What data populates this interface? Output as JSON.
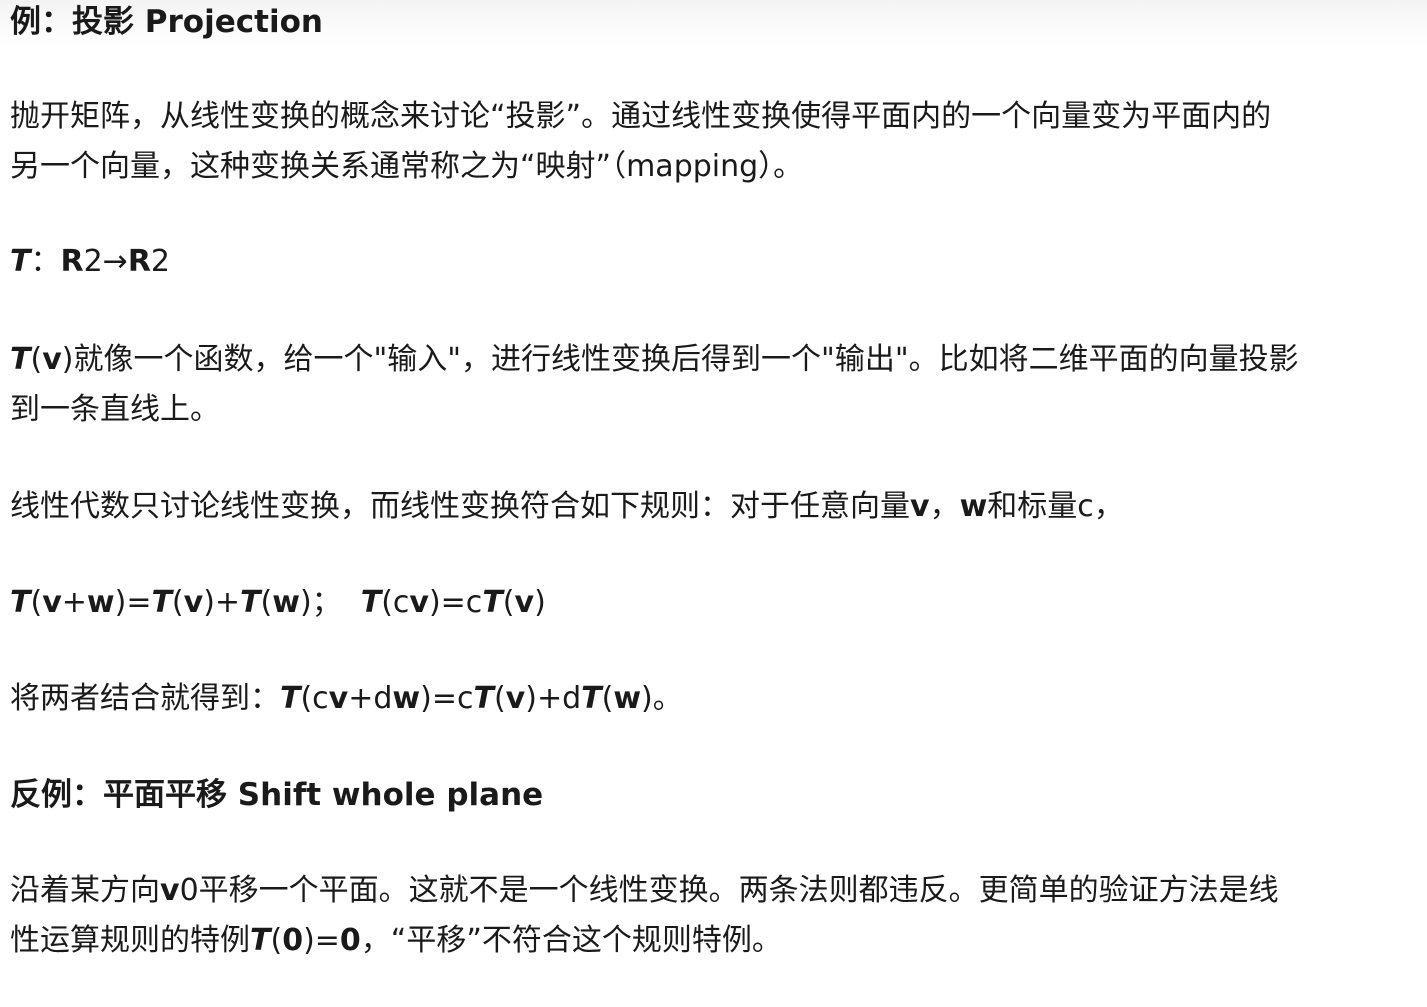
{
  "section1": {
    "heading": "例：投影 Projection",
    "para1": {
      "line1": "抛开矩阵，从线性变换的概念来讨论“投影”。通过线性变换使得平面内的一个向量变为平面内的",
      "line2": "另一个向量，这种变换关系通常称之为“映射”（mapping）。"
    },
    "mapping": {
      "T": "T",
      "colon": "：",
      "r2a": "R",
      "two_a": "2",
      "arrow": "→",
      "r2b": "R",
      "two_b": "2"
    },
    "para2": {
      "T": "T",
      "lp": "(",
      "v": "v",
      "rest1": ")就像一个函数，给一个\"输入\"，进行线性变换后得到一个\"输出\"。比如将二维平面的向量投影",
      "line2": "到一条直线上。"
    },
    "para3": {
      "text": "线性代数只讨论线性变换，而线性变换符合如下规则：对于任意向量",
      "v": "v",
      "comma": "，",
      "w": "w",
      "rest": "和标量c，"
    },
    "rules": {
      "T1": "T",
      "p1": "(",
      "v1": "v",
      "plus1": "+",
      "w1": "w",
      "p2": ")=",
      "T2": "T",
      "p3": "(",
      "v2": "v",
      "p4": ")+",
      "T3": "T",
      "p5": "(",
      "w2": "w",
      "p6": ")；  ",
      "T4": "T",
      "p7": "(c",
      "v3": "v",
      "p8": ")=c",
      "T5": "T",
      "p9": "(",
      "v4": "v",
      "p10": ")"
    },
    "combined": {
      "text": "将两者结合就得到：",
      "T1": "T",
      "p1": "(c",
      "v1": "v",
      "p2": "+d",
      "w1": "w",
      "p3": ")=c",
      "T2": "T",
      "p4": "(",
      "v2": "v",
      "p5": ")+d",
      "T3": "T",
      "p6": "(",
      "w2": "w",
      "p7": ")。"
    }
  },
  "section2": {
    "heading": "反例：平面平移 Shift whole plane",
    "para": {
      "line1a": "沿着某方向",
      "v0": "v",
      "line1b": "0平移一个平面。这就不是一个线性变换。两条法则都违反。更简单的验证方法是线",
      "line2a": "性运算规则的特例",
      "T": "T",
      "lp": "(",
      "zero1": "0",
      "rp": ")=",
      "zero2": "0",
      "line2b": "，“平移”不符合这个规则特例。"
    }
  }
}
